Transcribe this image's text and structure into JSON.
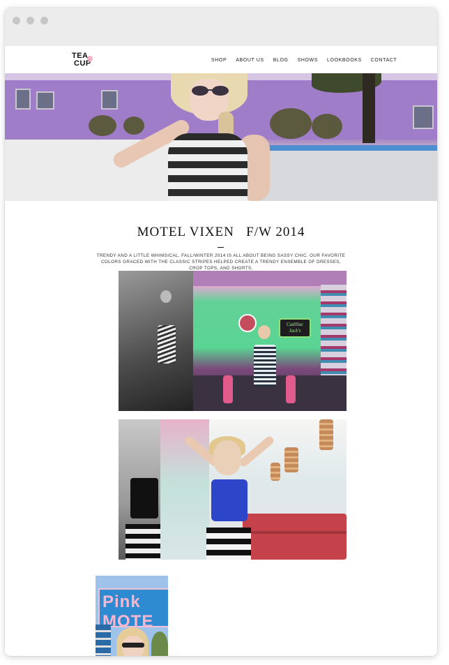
{
  "site": {
    "logo": {
      "line1": "TEA",
      "line2": "CUP"
    },
    "nav": [
      "SHOP",
      "ABOUT US",
      "BLOG",
      "SHOWS",
      "LOOKBOOKS",
      "CONTACT"
    ]
  },
  "lookbook": {
    "title": "MOTEL VIXEN   F/W 2014",
    "intro": "TRENDY AND A LITTLE WHIMSICAL, FALL/WINTER 2014 IS ALL ABOUT BEING SASSY CHIC. OUR FAVORITE COLORS GRACED WITH THE CLASSIC STRIPES HELPED CREATE A TRENDY ENSEMBLE OF DRESSES, CROP TOPS, AND SHORTS."
  },
  "photos": {
    "diner_sign": "Cadillac Jack's",
    "motel_sign": "Pink MOTE"
  },
  "colors": {
    "hero_wall": "#a07dc8",
    "accent_pink": "#f2a6c2",
    "diner_green": "#5ad493",
    "top_blue": "#2d45c9",
    "booth_red": "#c6424a"
  },
  "icons": {
    "logo_heart": "heart-icon",
    "window_controls": [
      "close-dot-icon",
      "minimize-dot-icon",
      "zoom-dot-icon"
    ]
  }
}
